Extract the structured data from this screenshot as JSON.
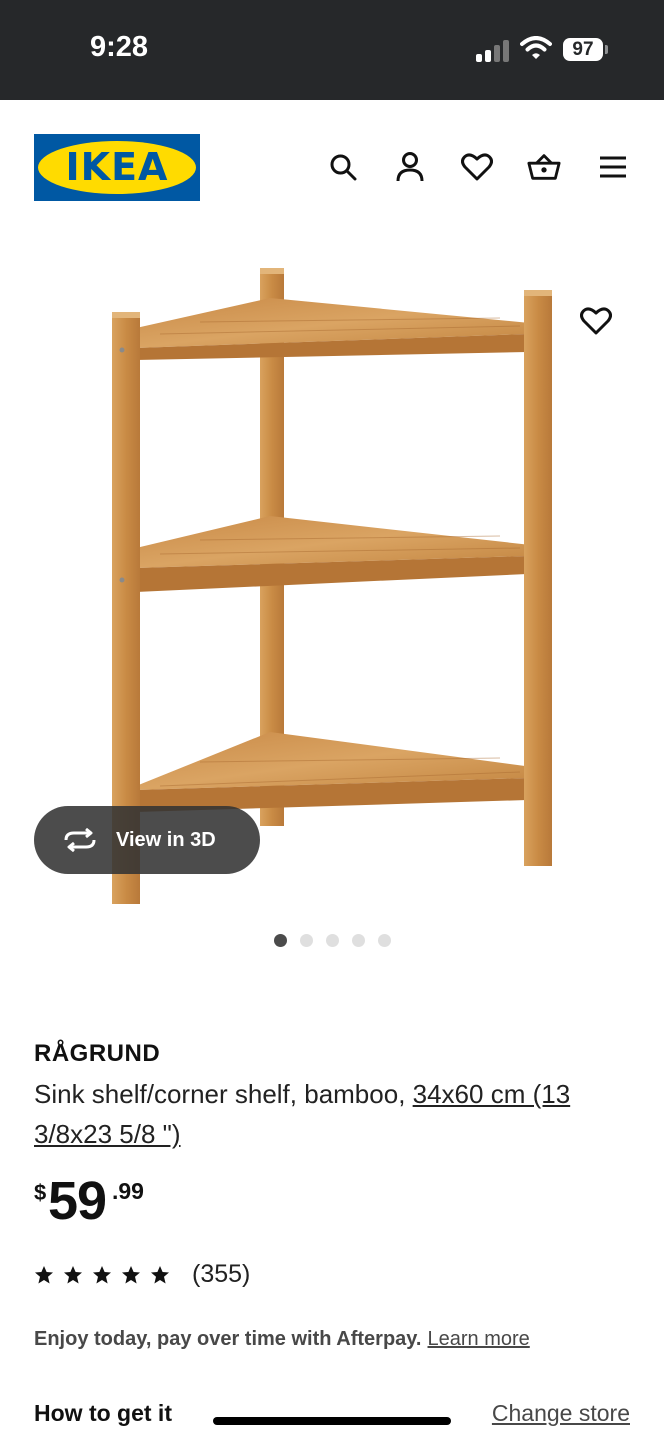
{
  "status_bar": {
    "time": "9:28",
    "battery": "97"
  },
  "header": {
    "logo_text": "IKEA",
    "icons": [
      "search-icon",
      "account-icon",
      "favourites-heart-icon",
      "shopping-basket-icon",
      "menu-icon"
    ]
  },
  "gallery": {
    "view_in_3d_label": "View in 3D",
    "image_count": 5,
    "active_image": 1
  },
  "product": {
    "name": "RÅGRUND",
    "description": "Sink shelf/corner shelf, bamboo, ",
    "size": "34x60 cm (13 3/8x23 5/8 \")",
    "price": {
      "currency": "$",
      "integer": "59",
      "decimal": ".99"
    },
    "rating": {
      "stars": 5,
      "count": "(355)"
    }
  },
  "afterpay": {
    "text": "Enjoy today, pay over time with Afterpay.",
    "link": "Learn more"
  },
  "delivery": {
    "title": "How to get it",
    "change_store": "Change store"
  },
  "colors": {
    "ikea_blue": "#0058a3",
    "ikea_yellow": "#ffdb00",
    "status_bar_bg": "#26282a"
  }
}
